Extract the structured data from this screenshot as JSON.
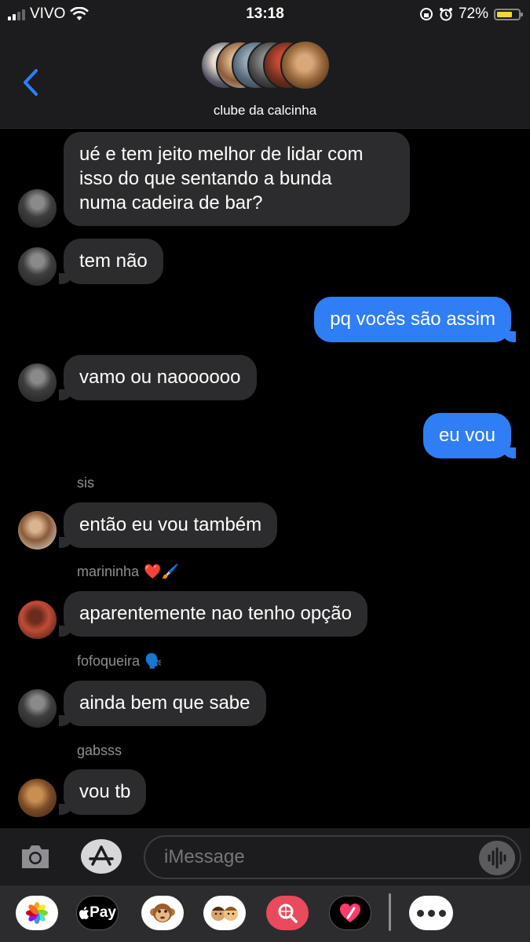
{
  "status_bar": {
    "carrier": "VIVO",
    "time": "13:18",
    "battery": "72%",
    "battery_level": 0.72
  },
  "header": {
    "group_name": "clube da calcinha",
    "back_icon": "chevron-left-icon",
    "accent": "#2f7ef6"
  },
  "messages": [
    {
      "direction": "in",
      "text_lines": [
        "ué e tem jeito melhor de lidar com",
        "isso do que sentando a bunda",
        "numa cadeira de bar?"
      ]
    },
    {
      "direction": "in",
      "text": "tem não"
    },
    {
      "direction": "out",
      "text": "pq vocês são assim"
    },
    {
      "direction": "in",
      "text": "vamo ou naoooooo"
    },
    {
      "direction": "out",
      "text": "eu vou"
    },
    {
      "direction": "in",
      "sender": "sis",
      "text": "então eu vou também"
    },
    {
      "direction": "in",
      "sender": "marininha",
      "sender_emoji": "❤️🖌️",
      "text": "aparentemente nao tenho opção"
    },
    {
      "direction": "in",
      "sender": "fofoqueira",
      "sender_emoji": "🗣️",
      "text": "ainda bem que sabe"
    },
    {
      "direction": "in",
      "sender": "gabsss",
      "text": "vou tb"
    }
  ],
  "input": {
    "placeholder": "iMessage"
  },
  "apps": {
    "pay_label": "Pay"
  },
  "colors": {
    "incoming_bubble": "#2c2c2e",
    "outgoing_bubble": "#2f7ef6",
    "background": "#000000"
  }
}
